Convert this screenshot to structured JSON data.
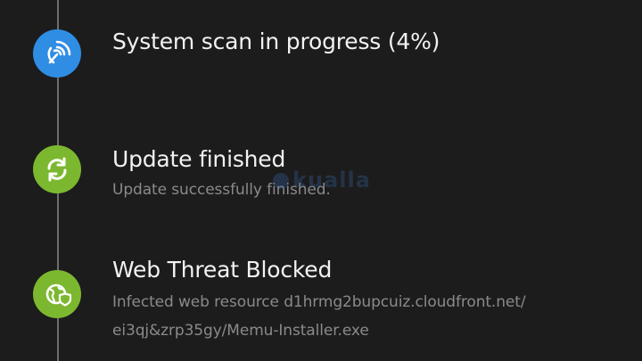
{
  "colors": {
    "background": "#1c1c1c",
    "scan_icon": "#2f8de4",
    "success_icon": "#7cb82f",
    "timeline": "#6e6e6e"
  },
  "events": [
    {
      "icon": "radar-icon",
      "title": "System scan in progress (4%)",
      "progress_percent": 4
    },
    {
      "icon": "refresh-icon",
      "title": "Update finished",
      "subtitle": "Update successfully finished."
    },
    {
      "icon": "globe-shield-icon",
      "title": "Web Threat Blocked",
      "subtitle_line1": "Infected web resource d1hrmg2bupcuiz.cloudfront.net/",
      "subtitle_line2": "ei3qj&zrp35gy/Memu-Installer.exe"
    }
  ],
  "watermark": {
    "text": "kualla"
  }
}
